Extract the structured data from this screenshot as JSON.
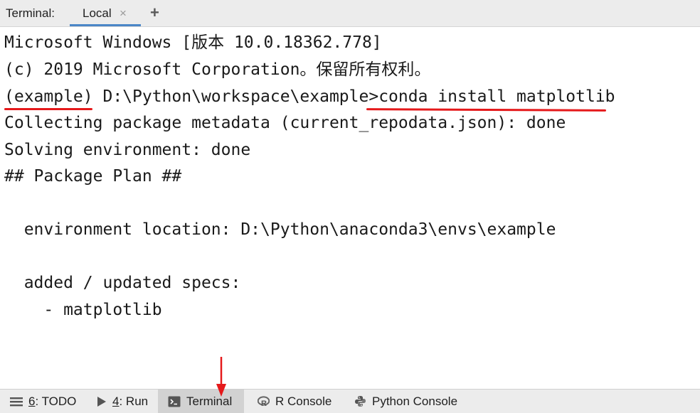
{
  "header": {
    "tool_title": "Terminal:",
    "tabs": [
      {
        "label": "Local",
        "close": "×"
      }
    ],
    "add_tab": "+"
  },
  "terminal": {
    "lines": [
      "Microsoft Windows [版本 10.0.18362.778]",
      "(c) 2019 Microsoft Corporation。保留所有权利。",
      "(example) D:\\Python\\workspace\\example>conda install matplotlib",
      "Collecting package metadata (current_repodata.json): done",
      "Solving environment: done",
      "## Package Plan ##",
      "",
      "  environment location: D:\\Python\\anaconda3\\envs\\example",
      "",
      "  added / updated specs:",
      "    - matplotlib"
    ],
    "annotation_color": "#e5191b"
  },
  "bottom_bar": {
    "todo": {
      "number": "6",
      "label": ": TODO"
    },
    "run": {
      "number": "4",
      "label": ": Run"
    },
    "terminal": {
      "label": "Terminal"
    },
    "r_console": {
      "label": "R Console"
    },
    "python_console": {
      "label": "Python Console"
    }
  }
}
